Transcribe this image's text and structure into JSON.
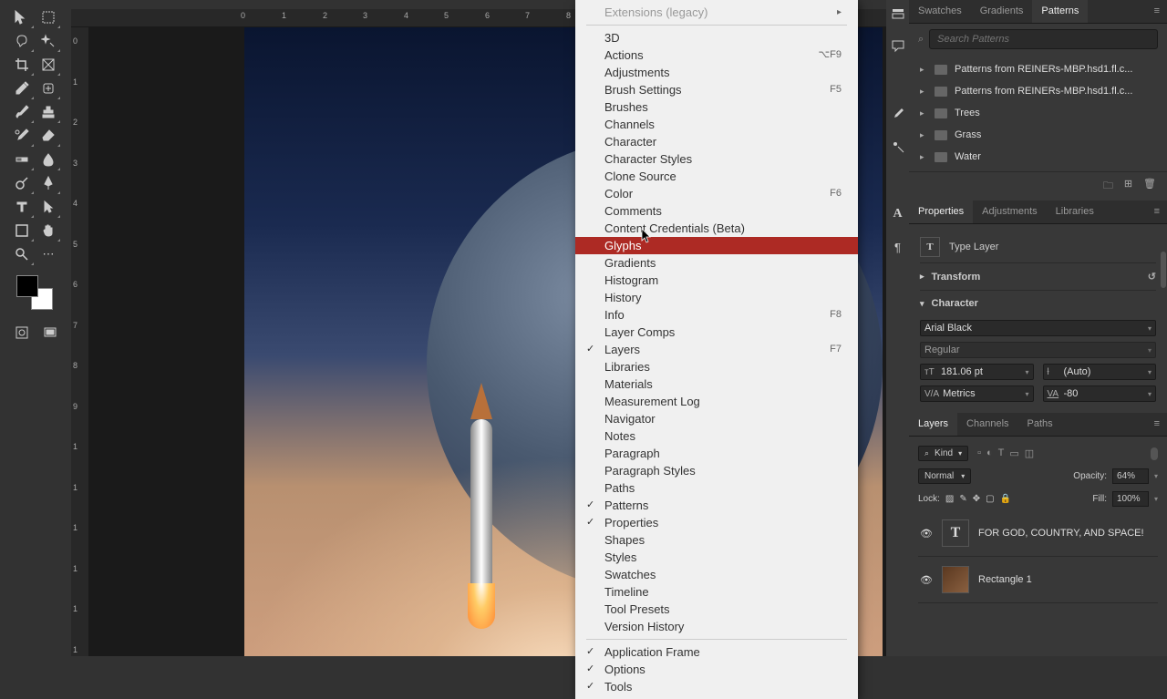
{
  "ruler_h": [
    "0",
    "1",
    "2",
    "3",
    "4",
    "5",
    "6",
    "7",
    "8"
  ],
  "ruler_v": [
    "0",
    "1",
    "2",
    "3",
    "4",
    "5",
    "6",
    "7",
    "8",
    "9",
    "1",
    "1",
    "1",
    "1",
    "1",
    "1"
  ],
  "canvas_text": "FOR GOD, COUNTRY, AND SPACE!",
  "menu": {
    "top_disabled": "Extensions (legacy)",
    "items": [
      {
        "label": "3D"
      },
      {
        "label": "Actions",
        "shortcut": "⌥F9"
      },
      {
        "label": "Adjustments"
      },
      {
        "label": "Brush Settings",
        "shortcut": "F5"
      },
      {
        "label": "Brushes"
      },
      {
        "label": "Channels"
      },
      {
        "label": "Character"
      },
      {
        "label": "Character Styles"
      },
      {
        "label": "Clone Source"
      },
      {
        "label": "Color",
        "shortcut": "F6"
      },
      {
        "label": "Comments"
      },
      {
        "label": "Content Credentials (Beta)"
      },
      {
        "label": "Glyphs",
        "highlighted": true
      },
      {
        "label": "Gradients"
      },
      {
        "label": "Histogram"
      },
      {
        "label": "History"
      },
      {
        "label": "Info",
        "shortcut": "F8"
      },
      {
        "label": "Layer Comps"
      },
      {
        "label": "Layers",
        "checked": true,
        "shortcut": "F7"
      },
      {
        "label": "Libraries"
      },
      {
        "label": "Materials"
      },
      {
        "label": "Measurement Log"
      },
      {
        "label": "Navigator"
      },
      {
        "label": "Notes"
      },
      {
        "label": "Paragraph"
      },
      {
        "label": "Paragraph Styles"
      },
      {
        "label": "Paths"
      },
      {
        "label": "Patterns",
        "checked": true
      },
      {
        "label": "Properties",
        "checked": true
      },
      {
        "label": "Shapes"
      },
      {
        "label": "Styles"
      },
      {
        "label": "Swatches"
      },
      {
        "label": "Timeline"
      },
      {
        "label": "Tool Presets"
      },
      {
        "label": "Version History"
      }
    ],
    "bottom": [
      {
        "label": "Application Frame",
        "checked": true
      },
      {
        "label": "Options",
        "checked": true
      },
      {
        "label": "Tools",
        "checked": true
      }
    ]
  },
  "patterns_panel": {
    "tabs": [
      "Swatches",
      "Gradients",
      "Patterns"
    ],
    "active_tab": 2,
    "search_placeholder": "Search Patterns",
    "groups": [
      "Patterns from REINERs-MBP.hsd1.fl.c...",
      "Patterns from REINERs-MBP.hsd1.fl.c...",
      "Trees",
      "Grass",
      "Water"
    ]
  },
  "props_panel": {
    "tabs": [
      "Properties",
      "Adjustments",
      "Libraries"
    ],
    "active_tab": 0,
    "layer_type": "Type Layer",
    "transform_label": "Transform",
    "character_label": "Character",
    "font": "Arial Black",
    "style": "Regular",
    "size": "181.06 pt",
    "leading": "(Auto)",
    "kerning": "Metrics",
    "tracking": "-80"
  },
  "layers_panel": {
    "tabs": [
      "Layers",
      "Channels",
      "Paths"
    ],
    "active_tab": 0,
    "kind": "Kind",
    "blend": "Normal",
    "opacity_label": "Opacity:",
    "opacity": "64%",
    "lock_label": "Lock:",
    "fill_label": "Fill:",
    "fill": "100%",
    "layers": [
      {
        "name": "FOR GOD, COUNTRY, AND SPACE!",
        "type": "text"
      },
      {
        "name": "Rectangle 1",
        "type": "shape"
      }
    ]
  }
}
